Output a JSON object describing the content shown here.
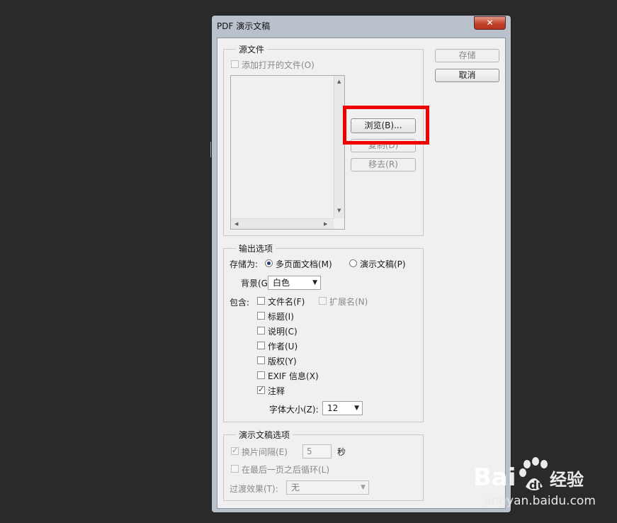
{
  "window": {
    "title": "PDF 演示文稿",
    "close_icon": "close-icon"
  },
  "buttons": {
    "save": "存储",
    "cancel": "取消",
    "browse": "浏览(B)...",
    "duplicate": "复制(D)",
    "remove": "移去(R)"
  },
  "source": {
    "legend": "源文件",
    "add_open_files": {
      "label": "添加打开的文件(O)",
      "checked": false,
      "enabled": false
    }
  },
  "output": {
    "legend": "输出选项",
    "save_as_label": "存储为:",
    "radio_multipage": {
      "label": "多页面文档(M)",
      "selected": true
    },
    "radio_presentation": {
      "label": "演示文稿(P)",
      "selected": false
    },
    "background_label": "背景(G):",
    "background_value": "白色",
    "include_label": "包含:",
    "include": [
      {
        "label": "文件名(F)",
        "checked": false
      },
      {
        "label": "扩展名(N)",
        "checked": false,
        "enabled": false
      },
      {
        "label": "标题(I)",
        "checked": false
      },
      {
        "label": "说明(C)",
        "checked": false
      },
      {
        "label": "作者(U)",
        "checked": false
      },
      {
        "label": "版权(Y)",
        "checked": false
      },
      {
        "label": "EXIF 信息(X)",
        "checked": false
      },
      {
        "label": "注释",
        "checked": true
      }
    ],
    "font_size_label": "字体大小(Z):",
    "font_size_value": "12"
  },
  "presentation": {
    "legend": "演示文稿选项",
    "advance": {
      "label": "换片间隔(E)",
      "checked": true,
      "enabled": false
    },
    "advance_value": "5",
    "advance_unit": "秒",
    "loop": {
      "label": "在最后一页之后循环(L)",
      "checked": false,
      "enabled": false
    },
    "transition_label": "过渡效果(T):",
    "transition_value": "无"
  },
  "watermark": {
    "brand": "Bai du 经验",
    "url": "jingyan.baidu.com"
  },
  "colors": {
    "highlight": "#f00000",
    "desktop": "#2a2a2a",
    "dialog": "#f0f0f0"
  }
}
